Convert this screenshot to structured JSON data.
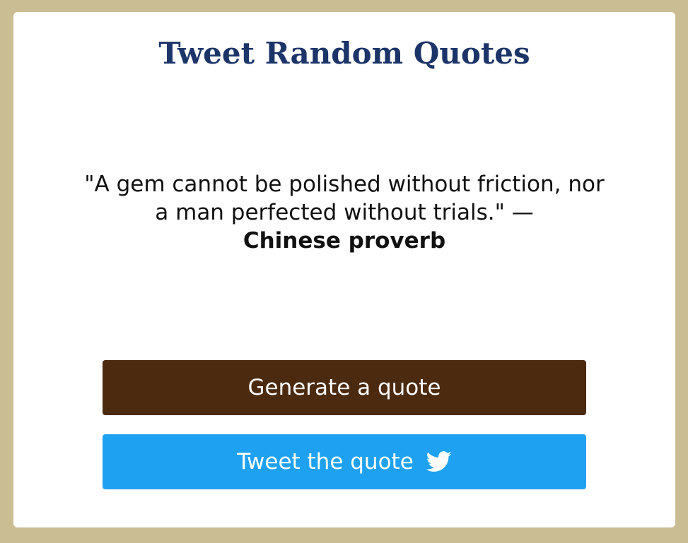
{
  "header": {
    "title": "Tweet Random Quotes"
  },
  "quote": {
    "text": "\"A gem cannot be polished without friction, nor a man perfected without trials.\"",
    "separator": " — ",
    "author": "Chinese proverb"
  },
  "buttons": {
    "generate_label": "Generate a quote",
    "tweet_label": "Tweet the quote",
    "tweet_icon": "twitter-bird-icon"
  },
  "colors": {
    "page_background": "#cabd94",
    "title": "#1c3569",
    "generate_button": "#4b2a10",
    "tweet_button": "#1fa1f1"
  }
}
